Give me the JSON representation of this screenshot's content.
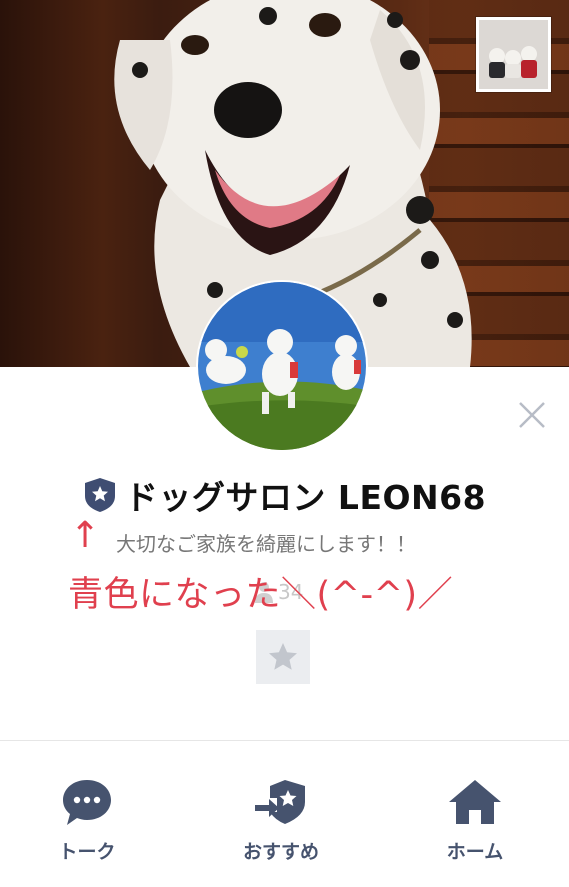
{
  "profile": {
    "name": "ドッグサロン LEON68",
    "status_message": "大切なご家族を綺麗にします！！",
    "friend_count": "34"
  },
  "annotation": {
    "arrow": "↑",
    "text": "青色になった＼(^-^)／",
    "color": "#e0404e"
  },
  "icons": {
    "close": "close-icon",
    "badge": "shield-star-icon",
    "favorite": "star-icon",
    "friends": "person-icon"
  },
  "bottom_nav": [
    {
      "label": "トーク",
      "icon": "chat-bubble-icon"
    },
    {
      "label": "おすすめ",
      "icon": "share-badge-icon"
    },
    {
      "label": "ホーム",
      "icon": "home-icon"
    }
  ],
  "colors": {
    "nav": "#46536e",
    "badge": "#3f4d72"
  }
}
